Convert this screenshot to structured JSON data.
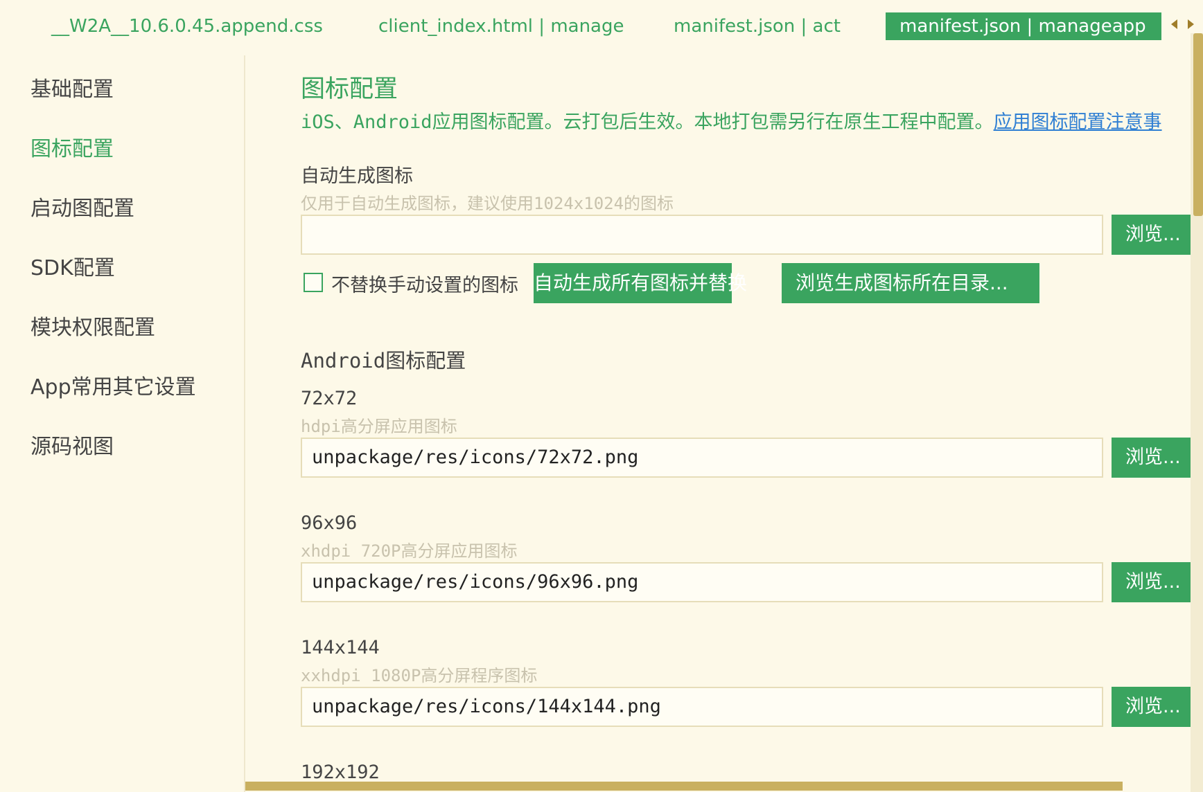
{
  "tabs": [
    {
      "label": "__W2A__10.6.0.45.append.css",
      "active": false
    },
    {
      "label": "client_index.html | manage",
      "active": false
    },
    {
      "label": "manifest.json | act",
      "active": false
    },
    {
      "label": "manifest.json | manageapp",
      "active": true
    }
  ],
  "sidebar": {
    "items": [
      {
        "label": "基础配置",
        "active": false
      },
      {
        "label": "图标配置",
        "active": true
      },
      {
        "label": "启动图配置",
        "active": false
      },
      {
        "label": "SDK配置",
        "active": false
      },
      {
        "label": "模块权限配置",
        "active": false
      },
      {
        "label": "App常用其它设置",
        "active": false
      },
      {
        "label": "源码视图",
        "active": false
      }
    ]
  },
  "main": {
    "title": "图标配置",
    "desc_prefix": "iOS、Android",
    "desc_text": "应用图标配置。云打包后生效。本地打包需另行在原生工程中配置。",
    "desc_link": "应用图标配置注意事",
    "auto": {
      "label": "自动生成图标",
      "hint": "仅用于自动生成图标，建议使用1024x1024的图标",
      "value": "",
      "browse_label": "浏览...",
      "checkbox_label": "不替换手动设置的图标",
      "checkbox_checked": false,
      "generate_label": "自动生成所有图标并替换",
      "open_dir_label": "浏览生成图标所在目录..."
    },
    "android": {
      "title_prefix": "Android",
      "title_suffix": "图标配置",
      "icons": [
        {
          "size": "72x72",
          "hint": "hdpi高分屏应用图标",
          "value": "unpackage/res/icons/72x72.png",
          "browse_label": "浏览..."
        },
        {
          "size": "96x96",
          "hint": "xhdpi 720P高分屏应用图标",
          "value": "unpackage/res/icons/96x96.png",
          "browse_label": "浏览..."
        },
        {
          "size": "144x144",
          "hint": "xxhdpi 1080P高分屏程序图标",
          "value": "unpackage/res/icons/144x144.png",
          "browse_label": "浏览..."
        },
        {
          "size": "192x192"
        }
      ]
    }
  },
  "colors": {
    "accent": "#3aa45f",
    "background": "#fdf9e8",
    "link": "#2f7fd3",
    "scrollbar": "#c9b060"
  }
}
